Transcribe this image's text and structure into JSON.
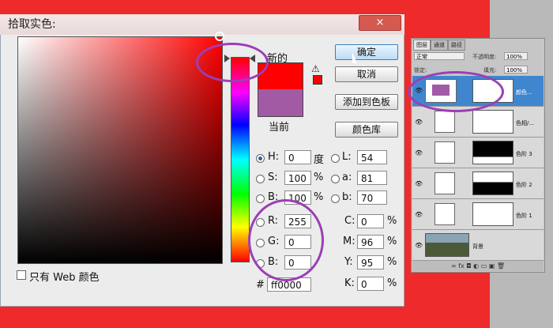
{
  "dialog": {
    "title": "拾取实色:",
    "close_icon": "×"
  },
  "swatch": {
    "new_label": "新的",
    "current_label": "当前",
    "warning_icon": "⚠",
    "new_color": "#ff0000",
    "current_color": "#a35aa5"
  },
  "buttons": {
    "ok": "确定",
    "cancel": "取消",
    "add_swatch": "添加到色板",
    "color_library": "颜色库"
  },
  "hsb": {
    "h": {
      "label": "H:",
      "value": "0",
      "unit": "度"
    },
    "s": {
      "label": "S:",
      "value": "100",
      "unit": "%"
    },
    "b": {
      "label": "B:",
      "value": "100",
      "unit": "%"
    }
  },
  "rgb": {
    "r": {
      "label": "R:",
      "value": "255"
    },
    "g": {
      "label": "G:",
      "value": "0"
    },
    "b": {
      "label": "B:",
      "value": "0"
    }
  },
  "lab": {
    "l": {
      "label": "L:",
      "value": "54"
    },
    "a": {
      "label": "a:",
      "value": "81"
    },
    "b": {
      "label": "b:",
      "value": "70"
    }
  },
  "cmyk": {
    "c": {
      "label": "C:",
      "value": "0",
      "unit": "%"
    },
    "m": {
      "label": "M:",
      "value": "96",
      "unit": "%"
    },
    "y": {
      "label": "Y:",
      "value": "95",
      "unit": "%"
    },
    "k": {
      "label": "K:",
      "value": "0",
      "unit": "%"
    }
  },
  "hex": {
    "label": "#",
    "value": "ff0000"
  },
  "web_only": "只有 Web 颜色",
  "layers_panel": {
    "tabs": [
      "图层",
      "通道",
      "路径"
    ],
    "blend_mode": "正常",
    "opacity_label": "不透明度:",
    "opacity_value": "100%",
    "lock_label": "锁定:",
    "fill_label": "填充:",
    "fill_value": "100%",
    "eye_icon": "👁",
    "layers": [
      {
        "name": "颜色..."
      },
      {
        "name": "色相/..."
      },
      {
        "name": "色阶 3"
      },
      {
        "name": "色阶 2"
      },
      {
        "name": "色阶 1"
      },
      {
        "name": "背景"
      }
    ],
    "bottom_icons": "∞ fx ◘ ◐ ▭ ▣ 🗑"
  },
  "colors": {
    "dialog_bg": "#ececec",
    "outer_bg": "#ee2a2a",
    "annotation": "#9b3fb5",
    "selected_layer": "#3f86cf"
  }
}
